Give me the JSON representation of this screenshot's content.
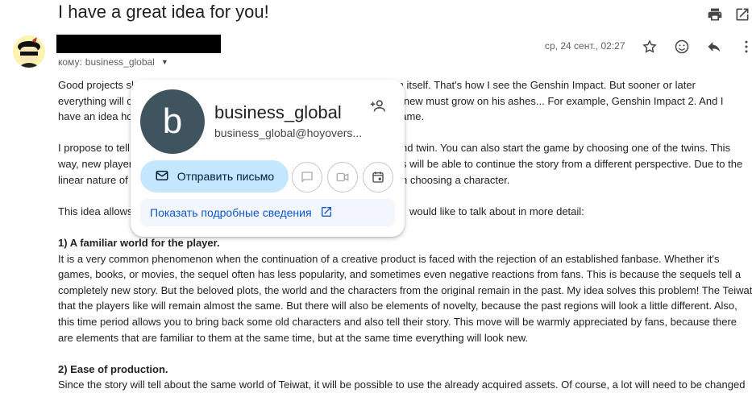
{
  "email": {
    "subject": "I have a great idea for you!",
    "recipient_prefix": "кому:",
    "recipient": "business_global",
    "date": "ср, 24 сент., 02:27"
  },
  "icons": {
    "print": "print-icon",
    "open_new_window": "open-in-new-icon",
    "star": "star-icon",
    "emoji": "emoji-icon",
    "reply": "reply-icon",
    "more": "more-vert-icon"
  },
  "body": {
    "p1": [
      "Good projects sl",
      "everything will c",
      "have an idea ho"
    ],
    "p1_right": [
      "m itself.  That's how I see the Genshin Impact. But sooner or later",
      "g new must grow on his ashes... For example, Genshin Impact 2. And I",
      "game."
    ],
    "p2": [
      "I propose to tell",
      "way, new player",
      "linear nature of"
    ],
    "p2_right": [
      "nd twin. You can also start the game by choosing one of the twins. This",
      "s will be able to continue the story from a different perspective. Due to the",
      "h choosing a character."
    ],
    "p3_left": "This idea allows",
    "p3_right": "would like to talk about in more detail:",
    "section1_title": "1) A familiar world for the player.",
    "section1_lines": [
      "It is a very common phenomenon when the continuation of a creative product is faced with the rejection of an established fanbase. Whether it's",
      "games, books, or movies, the sequel often has less popularity, and sometimes even negative reactions from fans. This is because the sequels tell a",
      "completely new story. But the beloved plots, the world and the characters from the original remain in the past. My idea solves this problem! The Teiwat",
      "that the players like will remain almost the same. But there will also be elements of novelty, because the past regions will look a little different.  Also,",
      "this time period allows you to bring back some old characters and also tell their story. This move will be warmly appreciated by fans, because there",
      "are elements that are familiar to them at the same time, but at the same time everything will look new."
    ],
    "section2_title": "2) Ease of production.",
    "section2_lines": [
      "Since the story will tell about the same world of Teiwat, it will be possible to use the already acquired assets. Of course, a lot will need to be changed"
    ]
  },
  "card": {
    "initial": "b",
    "name": "business_global",
    "email": "business_global@hoyovers...",
    "send_label": "Отправить письмо",
    "details_label": "Показать подробные сведения"
  },
  "colors": {
    "card_avatar_bg": "#3f545f",
    "send_button_bg": "#c2e7ff",
    "details_link": "#0b57d0"
  }
}
